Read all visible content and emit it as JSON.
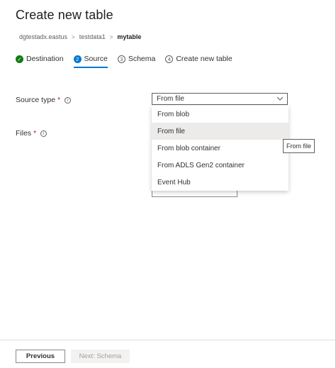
{
  "header": {
    "title": "Create new table"
  },
  "breadcrumb": [
    "dgtestadx.eastus",
    "testdata1",
    "mytable"
  ],
  "steps": [
    {
      "number": "",
      "label": "Destination",
      "state": "done"
    },
    {
      "number": "2",
      "label": "Source",
      "state": "active"
    },
    {
      "number": "3",
      "label": "Schema",
      "state": "pending"
    },
    {
      "number": "4",
      "label": "Create new table",
      "state": "pending"
    }
  ],
  "form": {
    "source_type_label": "Source type",
    "source_type_value": "From file",
    "files_label": "Files",
    "required_mark": "*"
  },
  "dropdown": {
    "options": [
      "From blob",
      "From file",
      "From blob container",
      "From ADLS Gen2 container",
      "Event Hub"
    ],
    "hovered": "From file"
  },
  "tooltip": "From file",
  "footer": {
    "previous_label": "Previous",
    "next_label": "Next: Schema"
  },
  "colors": {
    "accent": "#0078d4",
    "done": "#107c10",
    "required": "#a4262c"
  }
}
